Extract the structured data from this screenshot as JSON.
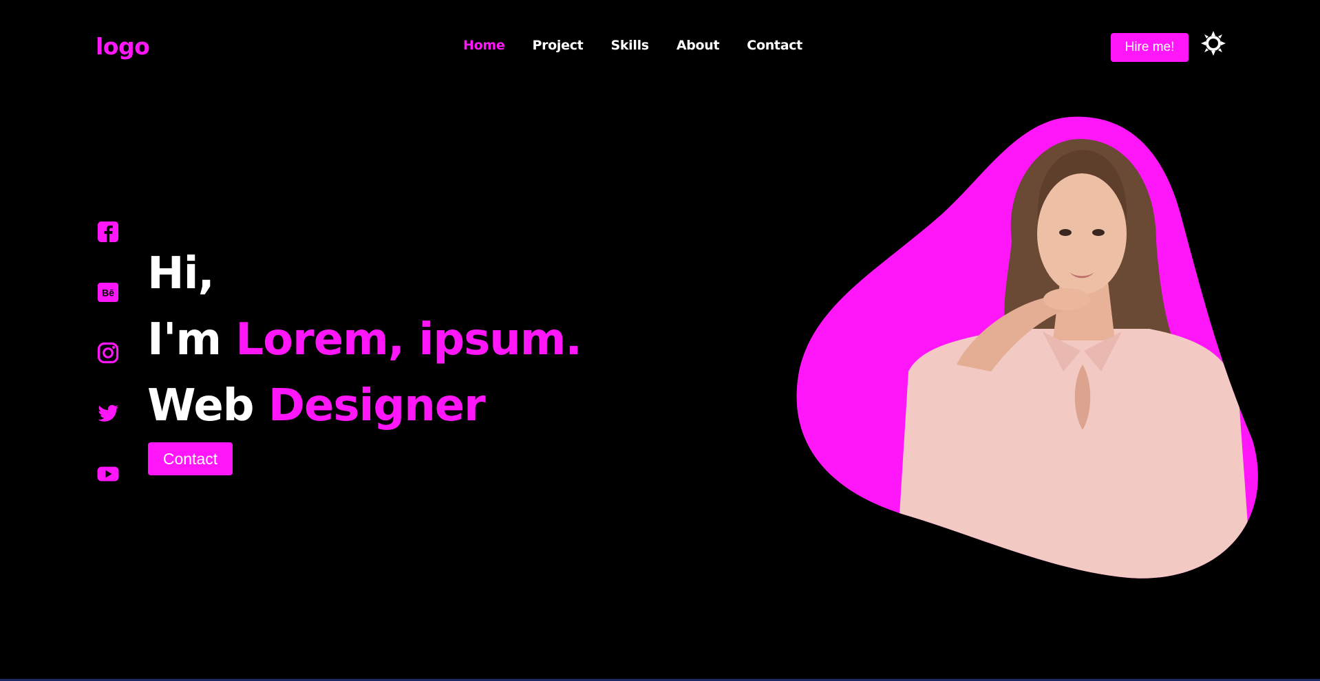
{
  "header": {
    "logo": "logo",
    "nav": [
      "Home",
      "Project",
      "Skills",
      "About",
      "Contact"
    ],
    "active_nav": "Home",
    "hire_label": "Hire me!",
    "theme_icon": "sun-icon"
  },
  "social": {
    "icons": [
      "facebook-icon",
      "behance-icon",
      "instagram-icon",
      "twitter-icon",
      "youtube-icon"
    ]
  },
  "hero": {
    "greeting": "Hi,",
    "intro_prefix": "I'm",
    "name": "Lorem, ipsum.",
    "role_prefix": "Web",
    "role": "Designer",
    "contact_label": "Contact"
  },
  "colors": {
    "accent": "#ff16f9",
    "background": "#000000",
    "text": "#ffffff"
  }
}
